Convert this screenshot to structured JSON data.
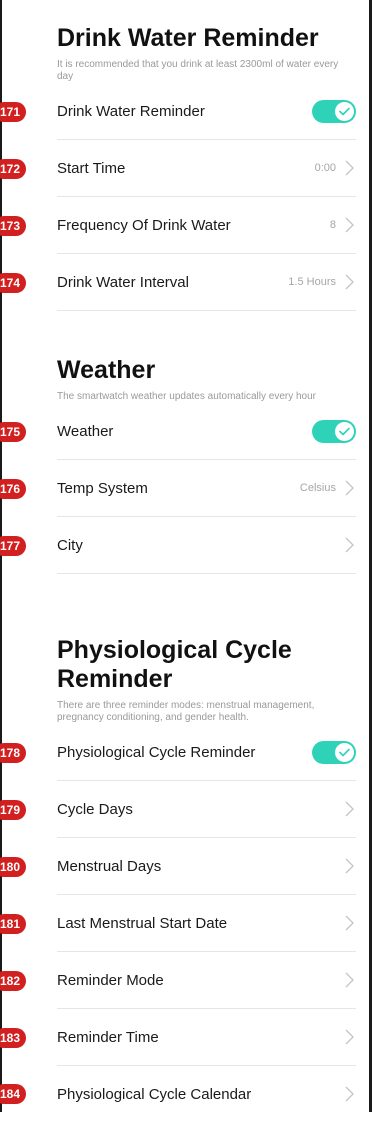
{
  "sections": [
    {
      "title": "Drink Water Reminder",
      "description": "It is recommended that you drink at least 2300ml of water every day",
      "rows": [
        {
          "badge": "171",
          "label": "Drink Water Reminder",
          "control": "toggle",
          "on": true
        },
        {
          "badge": "172",
          "label": "Start Time",
          "value": "0:00",
          "control": "chevron"
        },
        {
          "badge": "173",
          "label": "Frequency Of Drink Water",
          "value": "8",
          "control": "chevron"
        },
        {
          "badge": "174",
          "label": "Drink Water Interval",
          "value": "1.5 Hours",
          "control": "chevron"
        }
      ]
    },
    {
      "title": "Weather",
      "description": "The smartwatch weather updates automatically every hour",
      "rows": [
        {
          "badge": "175",
          "label": "Weather",
          "control": "toggle",
          "on": true
        },
        {
          "badge": "176",
          "label": "Temp System",
          "value": "Celsius",
          "control": "chevron"
        },
        {
          "badge": "177",
          "label": "City",
          "value": "",
          "control": "chevron"
        }
      ]
    },
    {
      "title": "Physiological Cycle Reminder",
      "description": "There are three reminder modes: menstrual management, pregnancy conditioning, and gender health.",
      "rows": [
        {
          "badge": "178",
          "label": "Physiological Cycle Reminder",
          "control": "toggle",
          "on": true
        },
        {
          "badge": "179",
          "label": "Cycle Days",
          "value": "",
          "control": "chevron"
        },
        {
          "badge": "180",
          "label": "Menstrual Days",
          "value": "",
          "control": "chevron"
        },
        {
          "badge": "181",
          "label": "Last Menstrual Start Date",
          "value": "",
          "control": "chevron"
        },
        {
          "badge": "182",
          "label": "Reminder Mode",
          "value": "",
          "control": "chevron"
        },
        {
          "badge": "183",
          "label": "Reminder Time",
          "value": "",
          "control": "chevron"
        },
        {
          "badge": "184",
          "label": "Physiological Cycle Calendar",
          "value": "",
          "control": "chevron"
        }
      ]
    }
  ],
  "colors": {
    "accent": "#2ed3b7",
    "badge": "#d22020"
  }
}
